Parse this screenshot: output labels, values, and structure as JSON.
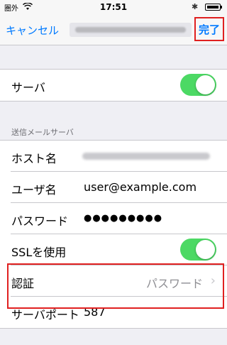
{
  "status_bar": {
    "carrier": "圏外",
    "time": "17:51",
    "bluetooth_icon": "bluetooth-icon",
    "battery_icon": "battery-icon",
    "wifi_icon": "wifi-icon"
  },
  "nav": {
    "cancel_label": "キャンセル",
    "done_label": "完了"
  },
  "server_row": {
    "label": "サーバ",
    "toggle_on": true
  },
  "section": {
    "header": "送信メールサーバ"
  },
  "rows": {
    "host_label": "ホスト名",
    "username_label": "ユーザ名",
    "username_value": "user@example.com",
    "password_label": "パスワード",
    "password_value": "●●●●●●●●●",
    "ssl_label": "SSLを使用",
    "ssl_toggle_on": true,
    "auth_label": "認証",
    "auth_value": "パスワード",
    "port_label": "サーバポート",
    "port_value": "587"
  },
  "colors": {
    "accent": "#007aff",
    "toggle_on": "#4cd964",
    "highlight_box": "#e02020"
  }
}
